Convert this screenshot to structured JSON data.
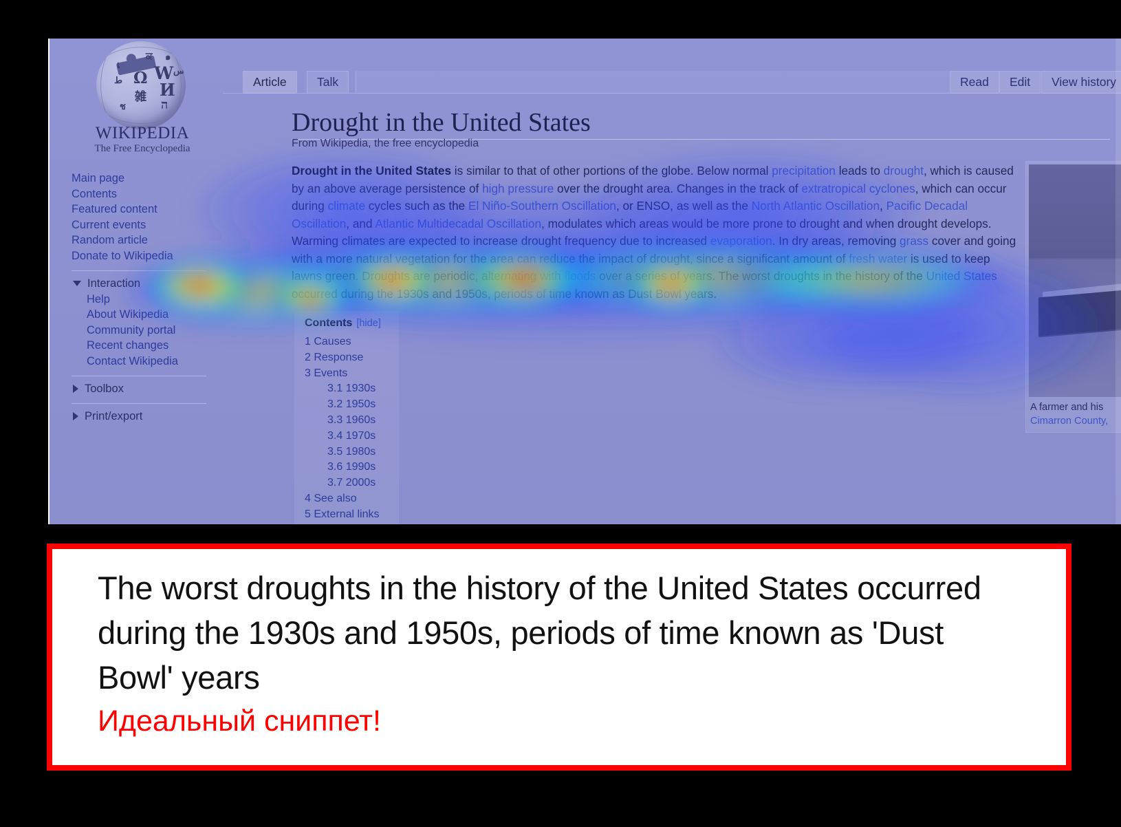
{
  "screenshot": {
    "site": {
      "wordmark": "WIKIPEDIA",
      "tagline": "The Free Encyclopedia"
    },
    "sidebar": {
      "main_links": [
        "Main page",
        "Contents",
        "Featured content",
        "Current events",
        "Random article",
        "Donate to Wikipedia"
      ],
      "sections": [
        {
          "label": "Interaction",
          "expanded": true,
          "items": [
            "Help",
            "About Wikipedia",
            "Community portal",
            "Recent changes",
            "Contact Wikipedia"
          ]
        },
        {
          "label": "Toolbox",
          "expanded": false,
          "items": []
        },
        {
          "label": "Print/export",
          "expanded": false,
          "items": []
        }
      ]
    },
    "tabs": {
      "left": [
        "Article",
        "Talk"
      ],
      "right": [
        "Read",
        "Edit",
        "View history"
      ],
      "active": "Article"
    },
    "article": {
      "title": "Drought in the United States",
      "subtitle": "From Wikipedia, the free encyclopedia",
      "lead_html": "<b>Drought in the United States</b> is similar to that of other portions of the globe. Below normal <span class=\"lnk\">precipitation</span> leads to <span class=\"lnk\">drought</span>, which is caused by an above average persistence of <span class=\"lnk\">high pressure</span> over the drought area. Changes in the track of <span class=\"lnk\">extratropical cyclones</span>, which can occur during <span class=\"lnk\">climate</span> cycles such as the <span class=\"lnk\">El Niño-Southern Oscillation</span>, or ENSO, as well as the <span class=\"lnk\">North Atlantic Oscillation</span>, <span class=\"lnk\">Pacific Decadal Oscillation</span>, and <span class=\"lnk\">Atlantic Multidecadal Oscillation</span>, modulates which areas would be more prone to drought and when drought develops. Warming climates are expected to increase drought frequency due to increased <span class=\"lnk\">evaporation</span>. In dry areas, removing <span class=\"lnk\">grass</span> cover and going with a more natural vegetation for the area can reduce the impact of drought, since a significant amount of <span class=\"lnk\">fresh water</span> is used to keep lawns green. Droughts are periodic, alternating with <span class=\"lnk\">floods</span> over a series of years. The worst droughts in the history of the <span class=\"lnk\">United States</span> occurred during the 1930s and 1950s, periods of time known as Dust Bowl years."
    },
    "toc": {
      "heading": "Contents",
      "hide_label": "[hide]",
      "entries": [
        {
          "text": "1 Causes",
          "level": 1
        },
        {
          "text": "2 Response",
          "level": 1
        },
        {
          "text": "3 Events",
          "level": 1
        },
        {
          "text": "3.1 1930s",
          "level": 2
        },
        {
          "text": "3.2 1950s",
          "level": 2
        },
        {
          "text": "3.3 1960s",
          "level": 2
        },
        {
          "text": "3.4 1970s",
          "level": 2
        },
        {
          "text": "3.5 1980s",
          "level": 2
        },
        {
          "text": "3.6 1990s",
          "level": 2
        },
        {
          "text": "3.7 2000s",
          "level": 2
        },
        {
          "text": "4 See also",
          "level": 1
        },
        {
          "text": "5 External links",
          "level": 1
        }
      ]
    },
    "thumbnail": {
      "caption_line1": "A farmer and his",
      "caption_line2": "Cimarron County,"
    },
    "overlay": {
      "type": "attention-heatmap",
      "colors": [
        "#0000ff",
        "#00ffff",
        "#00ff00",
        "#ffff00",
        "#ff8000",
        "#ff0000"
      ]
    }
  },
  "snippet_card": {
    "text": "The worst droughts in the history of the United States occurred during the 1930s and 1950s, periods of time known as 'Dust Bowl' years",
    "verdict": "Идеальный сниппет!",
    "border_color": "#ff0000",
    "verdict_color": "#ff0000"
  }
}
